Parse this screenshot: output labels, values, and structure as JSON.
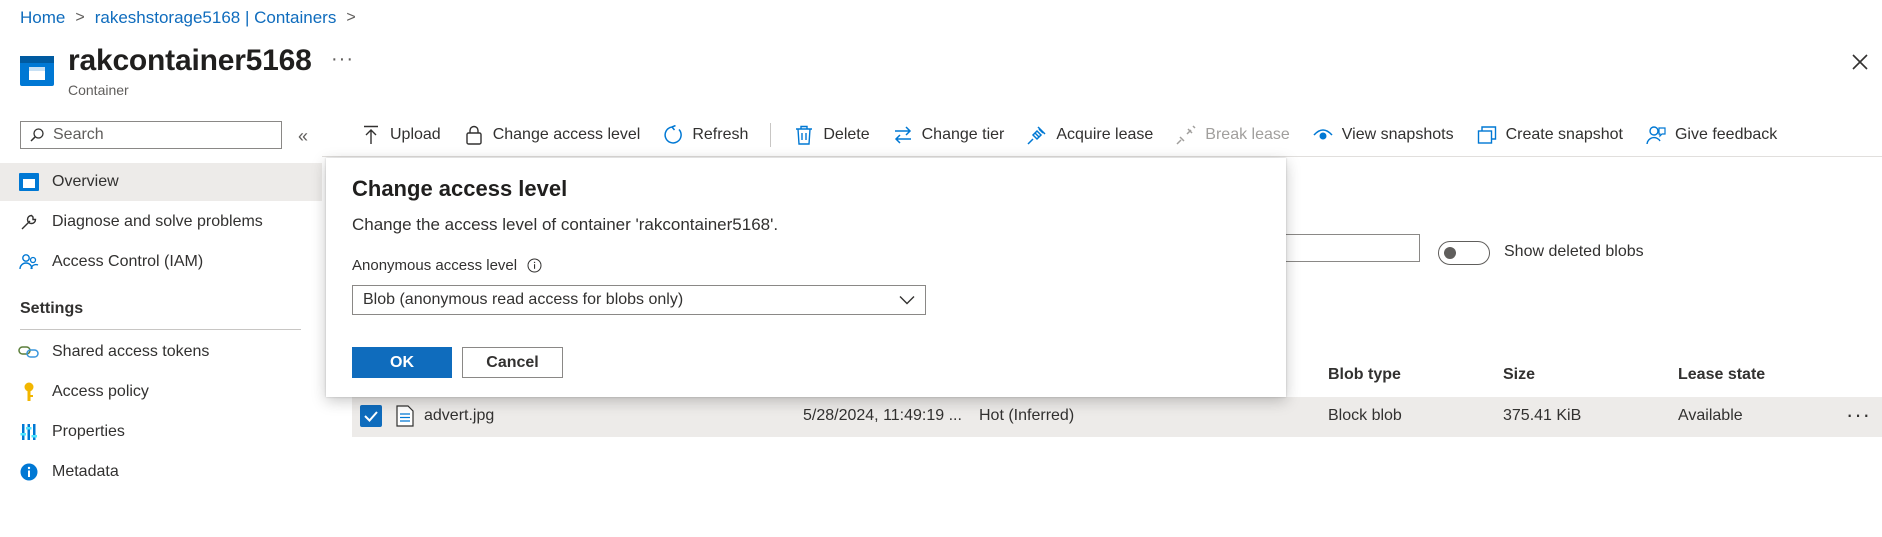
{
  "breadcrumb": {
    "home": "Home",
    "storage": "rakeshstorage5168 | Containers",
    "sep": ">"
  },
  "header": {
    "title": "rakcontainer5168",
    "more": "···",
    "subtitle": "Container"
  },
  "sidebar": {
    "search_placeholder": "Search",
    "collapse": "«",
    "items": [
      {
        "label": "Overview",
        "icon": "container-icon"
      },
      {
        "label": "Diagnose and solve problems",
        "icon": "wrench-icon"
      },
      {
        "label": "Access Control (IAM)",
        "icon": "people-icon"
      }
    ],
    "settings_heading": "Settings",
    "settings_items": [
      {
        "label": "Shared access tokens",
        "icon": "link-icon"
      },
      {
        "label": "Access policy",
        "icon": "key-icon"
      },
      {
        "label": "Properties",
        "icon": "properties-icon"
      },
      {
        "label": "Metadata",
        "icon": "info-icon"
      }
    ]
  },
  "toolbar": {
    "upload": "Upload",
    "change_access_level": "Change access level",
    "refresh": "Refresh",
    "delete": "Delete",
    "change_tier": "Change tier",
    "acquire_lease": "Acquire lease",
    "break_lease": "Break lease",
    "view_snapshots": "View snapshots",
    "create_snapshot": "Create snapshot",
    "give_feedback": "Give feedback"
  },
  "content": {
    "toggle_label": "Show deleted blobs",
    "toggle_on": false,
    "columns": {
      "blob_type": "Blob type",
      "size": "Size",
      "lease_state": "Lease state"
    },
    "row": {
      "checked": true,
      "name": "advert.jpg",
      "modified": "5/28/2024, 11:49:19 ...",
      "tier": "Hot (Inferred)",
      "blob_type": "Block blob",
      "size": "375.41 KiB",
      "lease_state": "Available",
      "more": "···"
    }
  },
  "dialog": {
    "title": "Change access level",
    "description": "Change the access level of container 'rakcontainer5168'.",
    "access_label": "Anonymous access level",
    "selected_option": "Blob (anonymous read access for blobs only)",
    "ok": "OK",
    "cancel": "Cancel"
  },
  "colors": {
    "accent": "#0f6cbd",
    "selected_row": "#edebe9",
    "text": "#323130"
  }
}
